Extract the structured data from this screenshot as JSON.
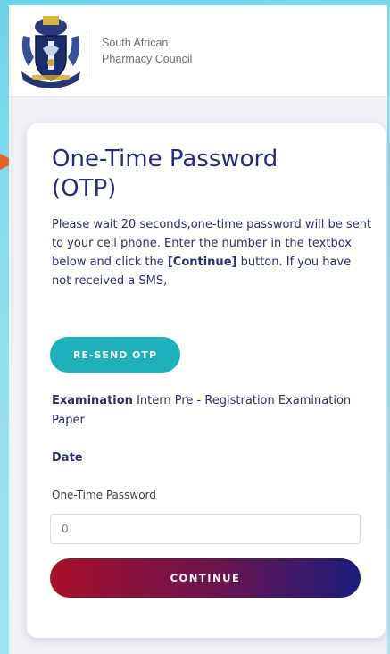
{
  "header": {
    "org_line1": "South African",
    "org_line2": "Pharmacy Council"
  },
  "otp": {
    "title_line1": "One-Time Password",
    "title_line2": "(OTP)",
    "desc_part1": "Please wait 20 seconds,one-time password will be sent to your cell phone. Enter the number in the textbox below and click the ",
    "desc_bracket_open": "[",
    "desc_bold": "Continue",
    "desc_bracket_close": "]",
    "desc_part2": " button. If you have not received a SMS,",
    "resend_label": "RE-SEND OTP",
    "exam_label": "Examination",
    "exam_value": " Intern Pre - Registration Examination Paper",
    "date_label": "Date",
    "password_label": "One-Time Password",
    "password_value": "0",
    "continue_label": "CONTINUE"
  },
  "colors": {
    "accent_teal": "#1fb1bb",
    "title_navy": "#242a7a",
    "arrow_orange": "#e2622a"
  }
}
